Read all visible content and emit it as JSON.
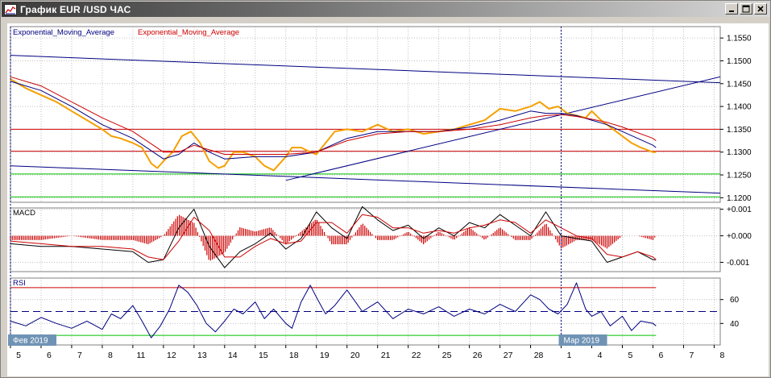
{
  "window": {
    "title": "График EUR /USD  ЧАС",
    "buttons": [
      "minimize",
      "maximize",
      "close"
    ]
  },
  "colors": {
    "price": "#f5a000",
    "ema_fast": "#000080",
    "ema_slow": "#cc0000",
    "support": "#00c000",
    "resistance": "#cc0000",
    "trend": "#000080",
    "grid": "#c0c0c0",
    "date_label_bg": "#6f93b5"
  },
  "chart_data": [
    {
      "type": "line",
      "panel": "price",
      "legend": [
        {
          "label": "Exponential_Moving_Average",
          "color": "#000080"
        },
        {
          "label": "Exponential_Moving_Average",
          "color": "#cc0000"
        }
      ],
      "ylim": [
        1.119,
        1.1575
      ],
      "y_ticks": [
        "1.1550",
        "1.1500",
        "1.1450",
        "1.1400",
        "1.1350",
        "1.1300",
        "1.1250",
        "1.1200"
      ],
      "x_ticks": [
        "5",
        "6",
        "7",
        "8",
        "11",
        "12",
        "13",
        "14",
        "15",
        "18",
        "19",
        "20",
        "21",
        "22",
        "25",
        "26",
        "27",
        "28",
        "1",
        "4",
        "5",
        "6",
        "7",
        "8"
      ],
      "date_labels": [
        {
          "text": "Фев 2019",
          "index": 0
        },
        {
          "text": "Мар 2019",
          "index": 18
        }
      ],
      "series": [
        {
          "key": "price",
          "x": [
            0,
            0.5,
            1,
            1.5,
            2,
            2.5,
            3,
            3.3,
            3.6,
            4,
            4.3,
            4.6,
            4.8,
            5,
            5.3,
            5.6,
            5.9,
            6.2,
            6.5,
            6.8,
            7,
            7.3,
            7.6,
            8,
            8.3,
            8.6,
            9,
            9.2,
            9.5,
            9.8,
            10,
            10.3,
            10.6,
            11,
            11.5,
            12,
            12.5,
            13,
            13.5,
            14,
            14.5,
            15,
            15.5,
            16,
            16.5,
            17,
            17.3,
            17.6,
            17.9,
            18.2,
            18.5,
            18.8,
            19,
            19.3,
            19.6,
            20,
            20.3,
            20.6,
            21,
            21.1
          ],
          "y": [
            1.146,
            1.144,
            1.1425,
            1.141,
            1.139,
            1.137,
            1.135,
            1.1335,
            1.133,
            1.132,
            1.131,
            1.1275,
            1.1265,
            1.128,
            1.13,
            1.1335,
            1.1345,
            1.132,
            1.128,
            1.1265,
            1.127,
            1.13,
            1.13,
            1.129,
            1.127,
            1.126,
            1.129,
            1.131,
            1.131,
            1.13,
            1.1295,
            1.132,
            1.1345,
            1.135,
            1.1345,
            1.136,
            1.1345,
            1.135,
            1.134,
            1.1345,
            1.135,
            1.136,
            1.137,
            1.1395,
            1.139,
            1.14,
            1.141,
            1.1395,
            1.14,
            1.1385,
            1.138,
            1.1375,
            1.139,
            1.137,
            1.1355,
            1.1335,
            1.132,
            1.131,
            1.13,
            1.13
          ]
        },
        {
          "key": "ema_fast",
          "x": [
            0,
            1,
            2,
            3,
            4,
            5,
            5.5,
            6,
            6.5,
            7,
            8,
            9,
            10,
            11,
            12,
            13,
            14,
            15,
            16,
            17,
            17.5,
            18,
            18.5,
            19,
            19.5,
            20,
            21,
            21.1
          ],
          "y": [
            1.1455,
            1.1435,
            1.14,
            1.136,
            1.133,
            1.1285,
            1.1295,
            1.132,
            1.13,
            1.1285,
            1.129,
            1.129,
            1.13,
            1.133,
            1.1345,
            1.1345,
            1.1345,
            1.1355,
            1.137,
            1.139,
            1.1385,
            1.1385,
            1.138,
            1.137,
            1.136,
            1.1345,
            1.1315,
            1.131
          ]
        },
        {
          "key": "ema_slow",
          "x": [
            0,
            1,
            2,
            3,
            4,
            5,
            5.5,
            6,
            6.5,
            7,
            8,
            9,
            10,
            11,
            12,
            13,
            14,
            15,
            16,
            17,
            17.5,
            18,
            18.5,
            19,
            19.5,
            20,
            21,
            21.1
          ],
          "y": [
            1.1465,
            1.1445,
            1.141,
            1.1375,
            1.1345,
            1.13,
            1.13,
            1.1315,
            1.1305,
            1.1295,
            1.1295,
            1.1295,
            1.13,
            1.1325,
            1.134,
            1.1345,
            1.1345,
            1.135,
            1.136,
            1.1375,
            1.138,
            1.1382,
            1.1378,
            1.1372,
            1.1365,
            1.1355,
            1.133,
            1.1325
          ]
        }
      ],
      "horizontal_lines": [
        {
          "y": 1.135,
          "color": "#cc0000"
        },
        {
          "y": 1.1302,
          "color": "#cc0000"
        },
        {
          "y": 1.1252,
          "color": "#00c000"
        },
        {
          "y": 1.1202,
          "color": "#00c000"
        }
      ],
      "trend_lines": [
        {
          "x1": 0,
          "y1": 1.1512,
          "x2": 23.2,
          "y2": 1.1452
        },
        {
          "x1": 0,
          "y1": 1.127,
          "x2": 23.2,
          "y2": 1.121
        },
        {
          "x1": 9,
          "y1": 1.1238,
          "x2": 23.2,
          "y2": 1.1465
        }
      ]
    },
    {
      "type": "line",
      "panel": "macd",
      "legend": [
        {
          "label": "MACD",
          "color": "#000000"
        }
      ],
      "ylim": [
        -0.00135,
        0.00105
      ],
      "y_ticks": [
        "+0.001",
        "+0.000",
        "-0.001"
      ],
      "series": [
        {
          "key": "macd",
          "x": [
            0,
            1,
            2,
            3,
            4,
            4.5,
            5,
            5.5,
            6,
            6.5,
            7,
            7.5,
            8,
            8.5,
            9,
            9.5,
            10,
            10.5,
            11,
            11.5,
            12,
            12.5,
            13,
            13.5,
            14,
            14.5,
            15,
            15.5,
            16,
            16.5,
            17,
            17.5,
            18,
            18.5,
            19,
            19.5,
            20,
            20.5,
            21,
            21.1
          ],
          "y": [
            -0.0003,
            -0.0004,
            -0.0004,
            -0.0005,
            -0.0006,
            -0.001,
            -0.0009,
            0.0003,
            0.001,
            -0.0004,
            -0.0012,
            -0.0006,
            -0.0003,
            0.0001,
            -0.0005,
            -0.0001,
            0.0009,
            0.0003,
            -0.0001,
            0.0011,
            0.0006,
            0.0002,
            0.0004,
            -0.0001,
            0.0003,
            0.0,
            0.0005,
            0.0003,
            0.0008,
            0.0004,
            0.0,
            0.0009,
            0.0,
            -0.0001,
            -0.0002,
            -0.001,
            -0.0008,
            -0.0006,
            -0.0009,
            -0.0009
          ]
        },
        {
          "key": "signal",
          "x": [
            0,
            1,
            2,
            3,
            4,
            4.5,
            5,
            5.5,
            6,
            6.5,
            7,
            7.5,
            8,
            8.5,
            9,
            9.5,
            10,
            10.5,
            11,
            11.5,
            12,
            12.5,
            13,
            13.5,
            14,
            14.5,
            15,
            15.5,
            16,
            16.5,
            17,
            17.5,
            18,
            18.5,
            19,
            19.5,
            20,
            20.5,
            21,
            21.1
          ],
          "y": [
            -0.0002,
            -0.0003,
            -0.0004,
            -0.0004,
            -0.0005,
            -0.0008,
            -0.0009,
            -0.0002,
            0.0007,
            0.0002,
            -0.0008,
            -0.0008,
            -0.0004,
            -0.0001,
            -0.0003,
            -0.0002,
            0.0005,
            0.0005,
            0.0001,
            0.0008,
            0.0007,
            0.0003,
            0.0003,
            0.0001,
            0.0002,
            0.0001,
            0.0003,
            0.0004,
            0.0006,
            0.0005,
            0.0001,
            0.0006,
            0.0003,
            0.0,
            -0.0001,
            -0.0007,
            -0.0008,
            -0.0006,
            -0.0008,
            -0.0009
          ]
        }
      ]
    },
    {
      "type": "line",
      "panel": "rsi",
      "legend": [
        {
          "label": "RSI",
          "color": "#000080"
        }
      ],
      "ylim": [
        22,
        78
      ],
      "y_ticks": [
        "60",
        "40"
      ],
      "levels": [
        {
          "y": 70,
          "color": "#cc0000",
          "style": "solid"
        },
        {
          "y": 50,
          "color": "#000080",
          "style": "dashed"
        },
        {
          "y": 30,
          "color": "#00c000",
          "style": "solid"
        }
      ],
      "series": [
        {
          "key": "rsi",
          "x": [
            0,
            0.5,
            1,
            1.5,
            2,
            2.5,
            3,
            3.3,
            3.6,
            4,
            4.3,
            4.6,
            4.9,
            5.2,
            5.5,
            5.8,
            6.1,
            6.4,
            6.7,
            7,
            7.3,
            7.6,
            8,
            8.3,
            8.6,
            9,
            9.2,
            9.5,
            9.8,
            10,
            10.3,
            10.6,
            11,
            11.5,
            12,
            12.5,
            13,
            13.5,
            14,
            14.5,
            15,
            15.5,
            16,
            16.5,
            17,
            17.3,
            17.6,
            17.9,
            18.2,
            18.5,
            18.8,
            19,
            19.3,
            19.6,
            20,
            20.3,
            20.6,
            21,
            21.1
          ],
          "y": [
            42,
            38,
            45,
            40,
            36,
            42,
            35,
            48,
            44,
            55,
            42,
            28,
            38,
            52,
            72,
            66,
            55,
            40,
            33,
            42,
            52,
            48,
            58,
            44,
            52,
            40,
            36,
            58,
            72,
            62,
            48,
            55,
            68,
            50,
            58,
            44,
            52,
            48,
            54,
            46,
            52,
            48,
            56,
            50,
            64,
            60,
            52,
            48,
            56,
            74,
            52,
            46,
            50,
            38,
            46,
            34,
            42,
            40,
            38
          ]
        }
      ]
    }
  ]
}
